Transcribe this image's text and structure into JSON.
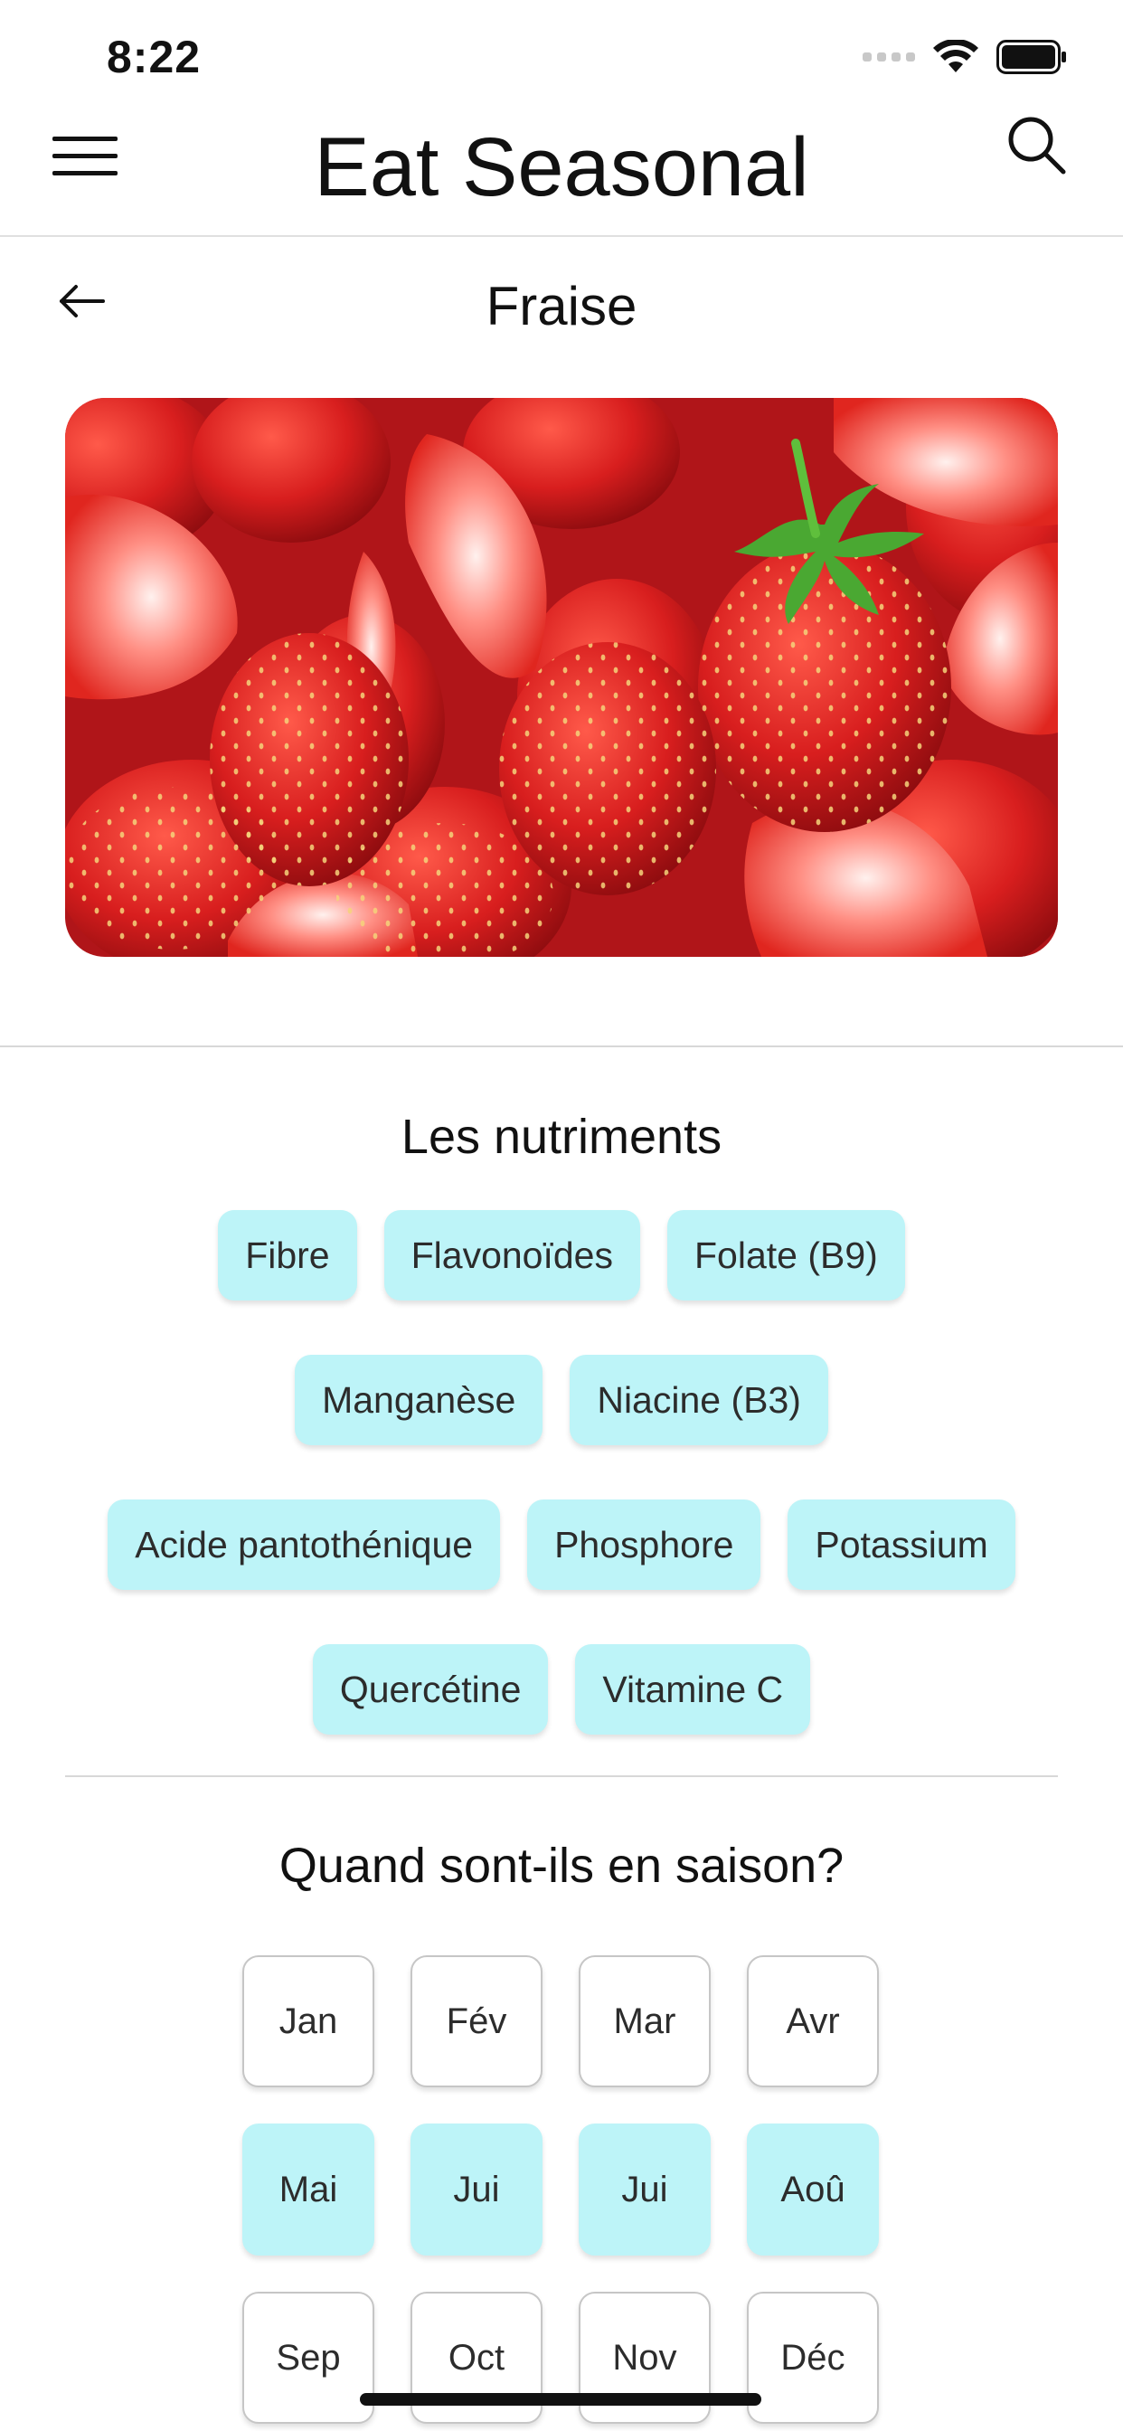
{
  "status_bar": {
    "time": "8:22"
  },
  "header": {
    "title": "Eat Seasonal",
    "menu_icon": "hamburger-menu-icon",
    "search_icon": "search-icon"
  },
  "detail": {
    "back_icon": "arrow-left-icon",
    "title": "Fraise",
    "image_subject": "strawberries"
  },
  "nutrients": {
    "title": "Les nutriments",
    "items": [
      "Fibre",
      "Flavonoïdes",
      "Folate (B9)",
      "Manganèse",
      "Niacine (B3)",
      "Acide pantothénique",
      "Phosphore",
      "Potassium",
      "Quercétine",
      "Vitamine C"
    ]
  },
  "season": {
    "title": "Quand sont-ils en saison?",
    "months": [
      {
        "label": "Jan",
        "in_season": false
      },
      {
        "label": "Fév",
        "in_season": false
      },
      {
        "label": "Mar",
        "in_season": false
      },
      {
        "label": "Avr",
        "in_season": false
      },
      {
        "label": "Mai",
        "in_season": true
      },
      {
        "label": "Jui",
        "in_season": true
      },
      {
        "label": "Jui",
        "in_season": true
      },
      {
        "label": "Aoû",
        "in_season": true
      },
      {
        "label": "Sep",
        "in_season": false
      },
      {
        "label": "Oct",
        "in_season": false
      },
      {
        "label": "Nov",
        "in_season": false
      },
      {
        "label": "Déc",
        "in_season": false
      }
    ]
  },
  "colors": {
    "chip_background": "#bdf4f8",
    "text": "#111111"
  }
}
